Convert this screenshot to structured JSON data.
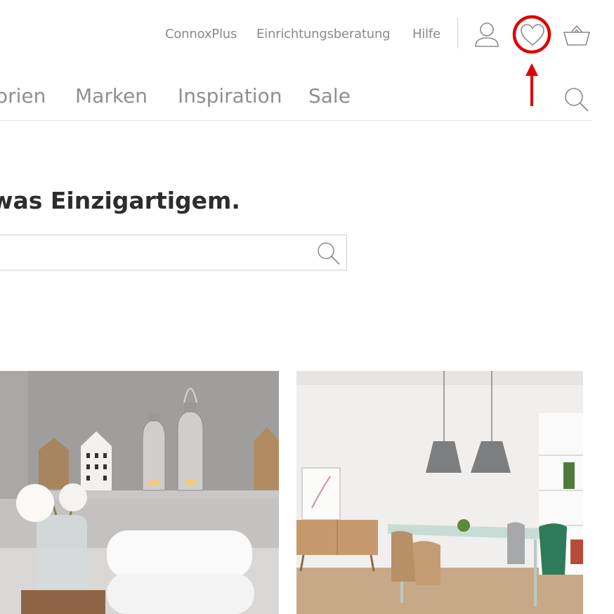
{
  "topnav": {
    "links": [
      "ConnoxPlus",
      "Einrichtungsberatung",
      "Hilfe"
    ],
    "icons": [
      "user-icon",
      "heart-icon",
      "basket-icon"
    ]
  },
  "mainnav": {
    "items": [
      "orien",
      "Marken",
      "Inspiration",
      "Sale"
    ],
    "search_icon": "search-icon"
  },
  "hero": {
    "headline": "was Einzigartigem.",
    "search_placeholder": ""
  },
  "annotation": {
    "highlight_color": "#e00000",
    "target": "heart-icon"
  },
  "tiles": [
    {
      "subject": "bathroom shelf with candle lanterns, wooden houses, flowers and towels"
    },
    {
      "subject": "dining room with grey pendant lamps, table and chairs"
    }
  ]
}
